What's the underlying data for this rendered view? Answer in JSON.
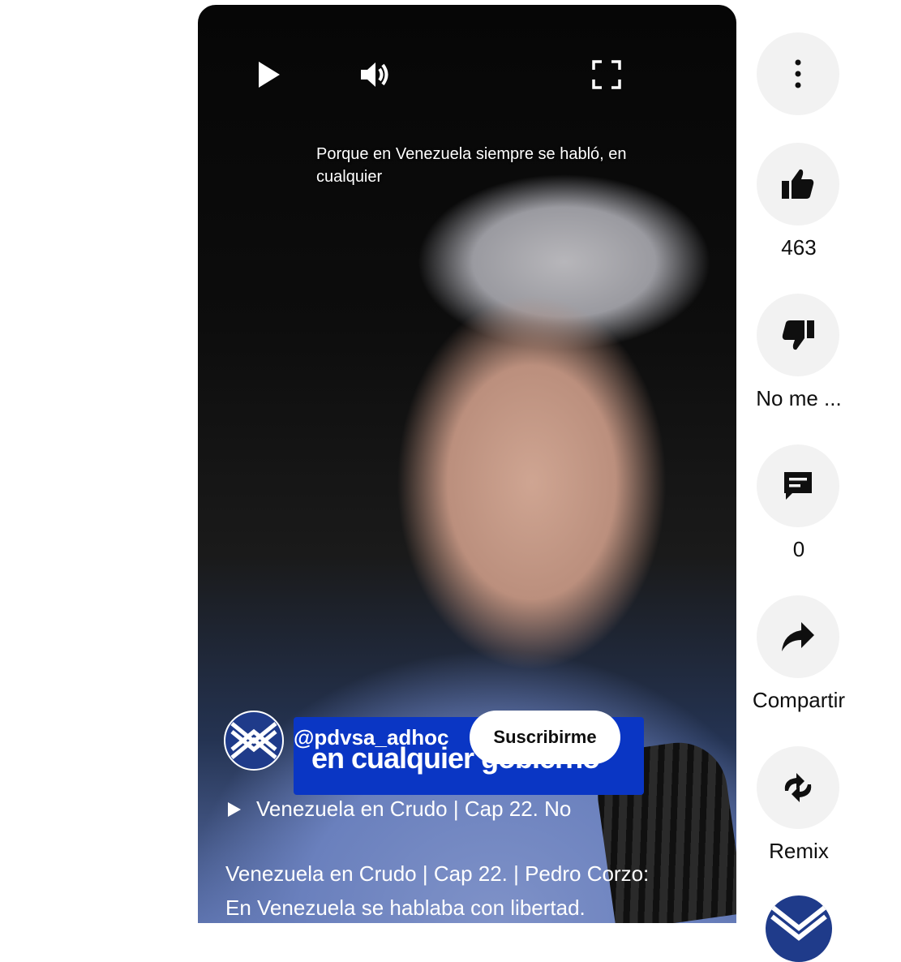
{
  "player": {
    "caption": "Porque en Venezuela siempre se habló, en cualquier",
    "burned_subtitle": "en cualquier gobierno",
    "channel_handle": "@pdvsa_adhoc",
    "subscribe_label": "Suscribirme",
    "related_video": "Venezuela en Crudo | Cap 22. No",
    "title_line1": "Venezuela en Crudo | Cap 22. | Pedro Corzo:",
    "title_line2": "En Venezuela se hablaba con libertad."
  },
  "actions": {
    "likes": "463",
    "dislike_label": "No me ...",
    "comments": "0",
    "share_label": "Compartir",
    "remix_label": "Remix"
  }
}
